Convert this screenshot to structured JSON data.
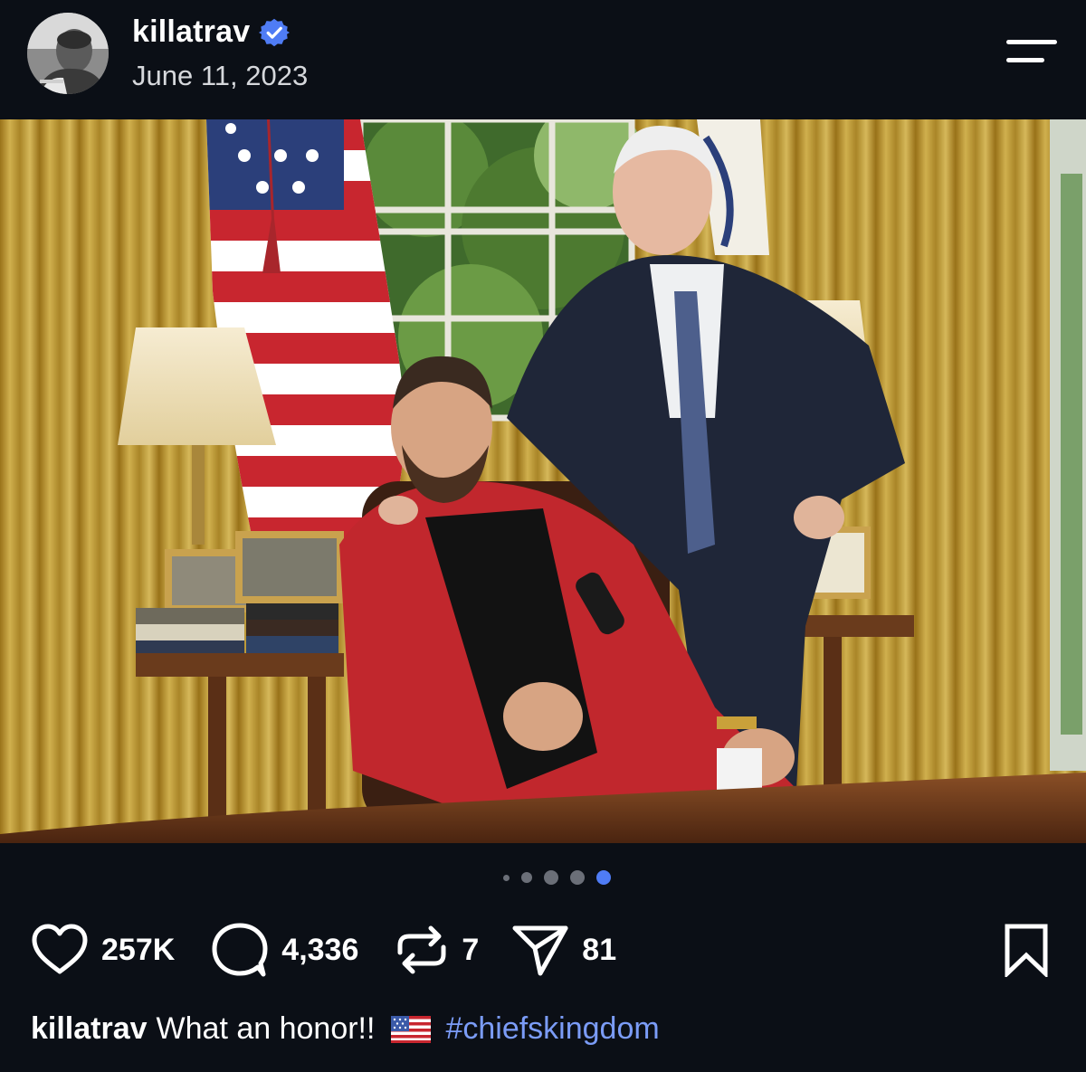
{
  "post": {
    "username": "killatrav",
    "date": "June 11, 2023",
    "verified": true
  },
  "icons": {
    "avatar": "avatar-profile-photo",
    "verified": "verified-badge-icon",
    "menu": "menu-icon",
    "like": "heart-icon",
    "comment": "comment-bubble-icon",
    "repost": "repost-icon",
    "share": "send-paper-plane-icon",
    "save": "bookmark-icon",
    "flag": "us-flag-emoji"
  },
  "carousel": {
    "total": 5,
    "current": 5
  },
  "stats": {
    "likes": "257K",
    "comments": "4,336",
    "reposts": "7",
    "shares": "81"
  },
  "caption": {
    "username": "killatrav",
    "text": "What an honor!!",
    "hashtag": "#chiefskingdom"
  },
  "colors": {
    "background": "#0b0f16",
    "verified_badge": "#4f7cf5",
    "hashtag": "#7b9cf7",
    "active_dot": "#4f7cf5"
  }
}
